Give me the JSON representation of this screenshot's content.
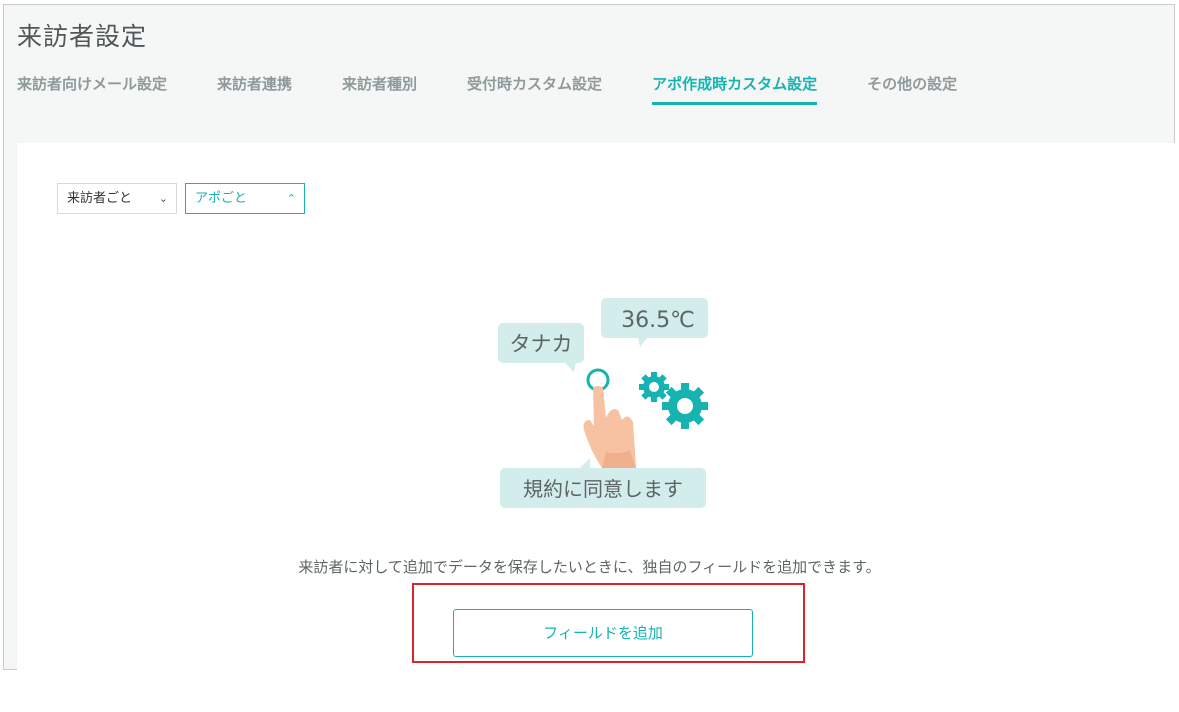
{
  "page": {
    "title": "来訪者設定"
  },
  "tabs": [
    {
      "label": "来訪者向けメール設定"
    },
    {
      "label": "来訪者連携"
    },
    {
      "label": "来訪者種別"
    },
    {
      "label": "受付時カスタム設定"
    },
    {
      "label": "アポ作成時カスタム設定"
    },
    {
      "label": "その他の設定"
    }
  ],
  "filters": {
    "scope_select": {
      "value": "来訪者ごと",
      "icon": "chevron-down-icon"
    },
    "appointment_select": {
      "value": "アポごと",
      "icon": "chevron-up-icon"
    }
  },
  "illustration": {
    "bubble_name": "タナカ",
    "bubble_temperature": "36.5℃",
    "bubble_agree": "規約に同意します"
  },
  "empty_state": {
    "description": "来訪者に対して追加でデータを保存したいときに、独自のフィールドを追加できます。",
    "add_button_label": "フィールドを追加"
  },
  "colors": {
    "accent": "#16b3b0",
    "highlight": "#d6262b",
    "bubble": "#d3ecec"
  }
}
